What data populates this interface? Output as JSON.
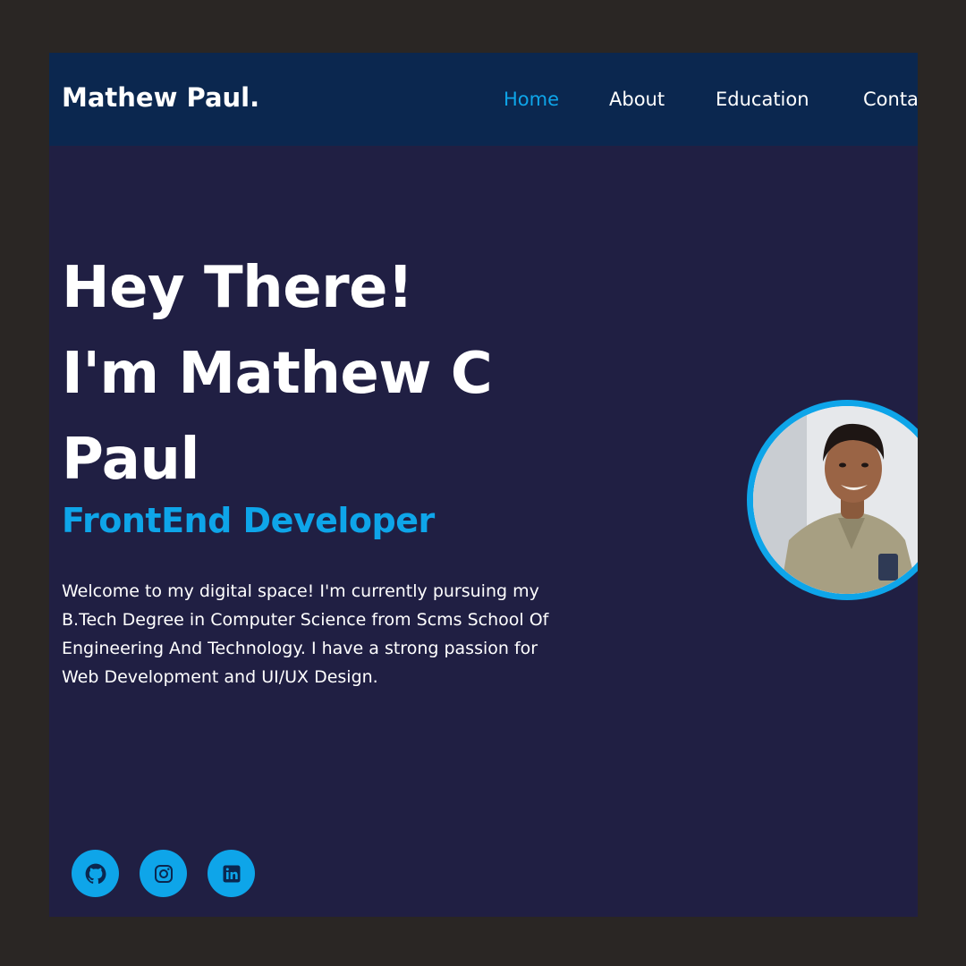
{
  "nav": {
    "brand": "Mathew Paul.",
    "links": [
      {
        "label": "Home",
        "active": true
      },
      {
        "label": "About",
        "active": false
      },
      {
        "label": "Education",
        "active": false
      },
      {
        "label": "Contact",
        "active": false
      }
    ]
  },
  "hero": {
    "title_lines": [
      "Hey There!",
      "I'm Mathew C",
      "Paul"
    ],
    "role": "FrontEnd Developer",
    "description": "Welcome to my digital space! I'm currently pursuing my B.Tech Degree in Computer Science from Scms School Of Engineering And Technology. I have a strong passion for Web Development and UI/UX Design."
  },
  "socials": [
    {
      "icon": "github-icon"
    },
    {
      "icon": "instagram-icon"
    },
    {
      "icon": "linkedin-icon"
    }
  ],
  "colors": {
    "page_background": "#2a2624",
    "content_background": "#201f43",
    "navbar_background": "#0b274f",
    "accent": "#0ea5e9",
    "text": "#ffffff"
  }
}
